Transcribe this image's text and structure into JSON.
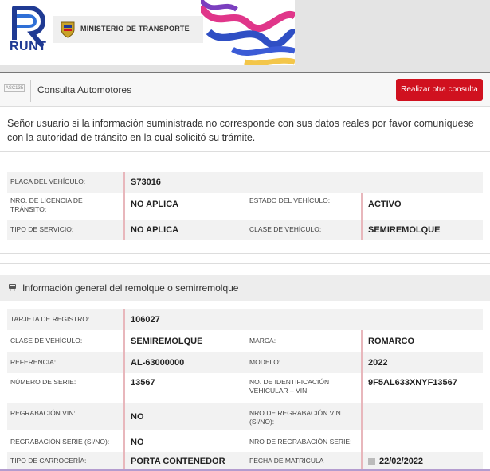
{
  "header": {
    "logo_text": "RUNT",
    "ministry": "MINISTERIO DE TRANSPORTE"
  },
  "query_bar": {
    "icon_label": "ASC135",
    "title": "Consulta Automotores",
    "button_label": "Realizar otra consulta"
  },
  "notice": "Señor usuario si la información suministrada no corresponde con sus datos reales por favor comuníquese con la autoridad de tránsito en la cual solicitó su trámite.",
  "vehicle": {
    "placa_label": "PLACA DEL VEHÍCULO:",
    "placa_value": "S73016",
    "licencia_label": "NRO. DE LICENCIA DE TRÁNSITO:",
    "licencia_value": "NO APLICA",
    "estado_label": "ESTADO DEL VEHÍCULO:",
    "estado_value": "ACTIVO",
    "servicio_label": "TIPO DE SERVICIO:",
    "servicio_value": "NO APLICA",
    "clase_label": "CLASE DE VEHÍCULO:",
    "clase_value": "SEMIREMOLQUE"
  },
  "section": {
    "title": "Información general del remolque o semirremolque"
  },
  "general": {
    "tarjeta_label": "TARJETA DE REGISTRO:",
    "tarjeta_value": "106027",
    "clase_label": "CLASE DE VEHÍCULO:",
    "clase_value": "SEMIREMOLQUE",
    "marca_label": "MARCA:",
    "marca_value": "ROMARCO",
    "referencia_label": "REFERENCIA:",
    "referencia_value": "AL-63000000",
    "modelo_label": "MODELO:",
    "modelo_value": "2022",
    "serie_label": "NÚMERO DE SERIE:",
    "serie_value": "13567",
    "vin_label": "NO. DE IDENTIFICACIÓN VEHICULAR – VIN:",
    "vin_value": "9F5AL633XNYF13567",
    "regrab_vin_label": "REGRABACIÓN VIN:",
    "regrab_vin_value": "NO",
    "nro_regrab_vin_label": "NRO DE REGRABACIÓN VIN (SI/NO):",
    "nro_regrab_vin_value": "",
    "regrab_serie_label": "REGRABACIÓN SERIE (SI/NO):",
    "regrab_serie_value": "NO",
    "nro_regrab_serie_label": "NRO DE REGRABACIÓN SERIE:",
    "nro_regrab_serie_value": "",
    "carroceria_label": "TIPO DE CARROCERÍA:",
    "carroceria_value": "PORTA CONTENEDOR",
    "matricula_label": "FECHA DE MATRICULA",
    "matricula_value": "22/02/2022"
  }
}
